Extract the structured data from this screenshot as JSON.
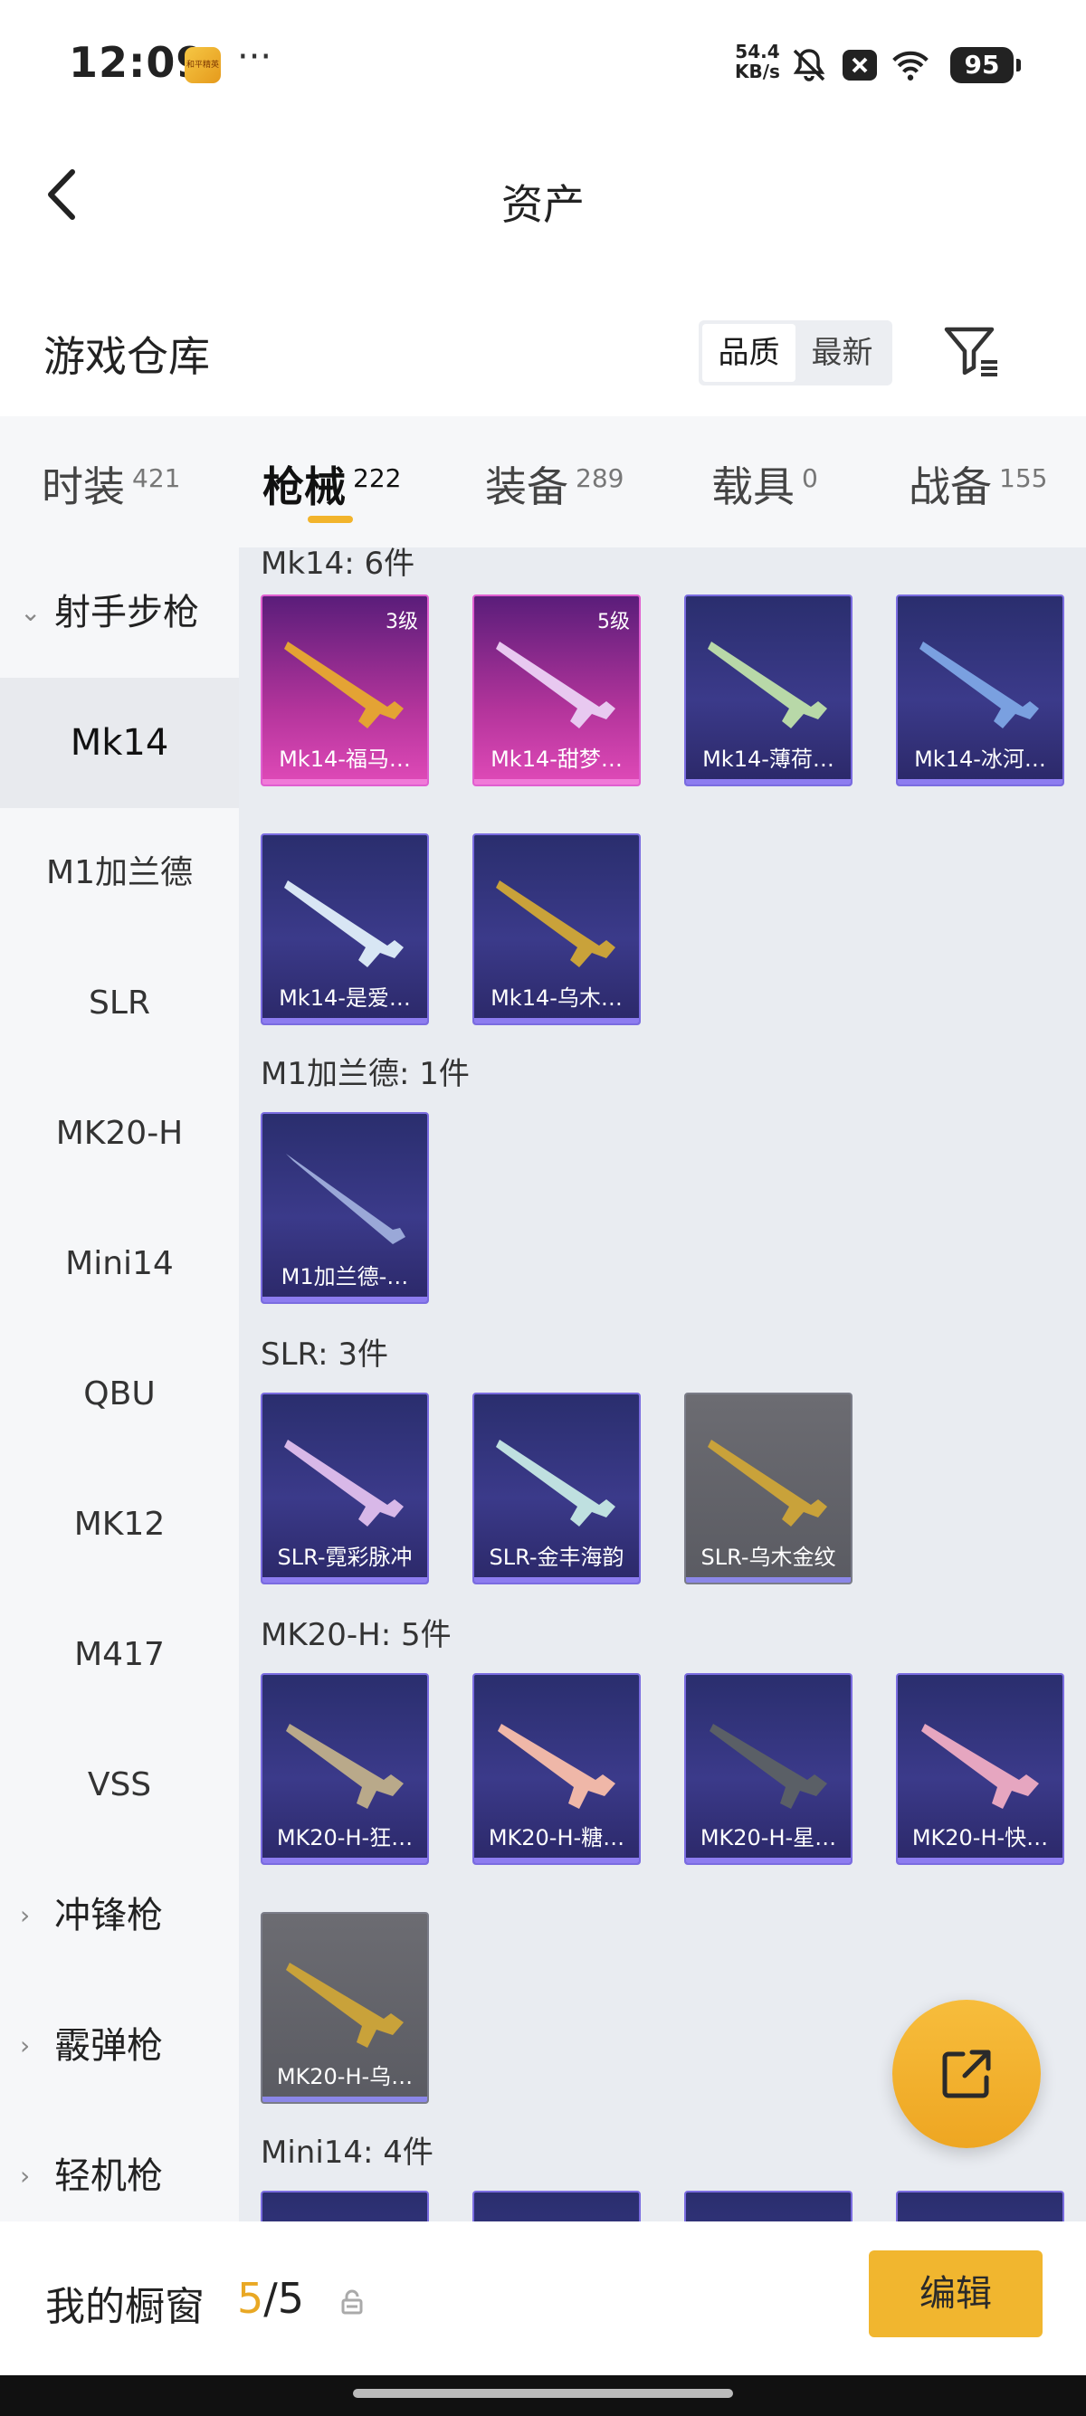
{
  "status_bar": {
    "time": "12:09",
    "app_badge_text": "和平精英",
    "more": "···",
    "net_speed_value": "54.4",
    "net_speed_unit": "KB/s",
    "battery": "95",
    "icons": [
      "bell-off-icon",
      "close-box-icon",
      "wifi-icon",
      "battery-icon"
    ]
  },
  "nav": {
    "title": "资产",
    "back_icon": "chevron-left-icon"
  },
  "header": {
    "title": "游戏仓库",
    "sort_options": [
      "品质",
      "最新"
    ],
    "sort_selected": "品质",
    "filter_icon": "filter-icon"
  },
  "tabs": [
    {
      "label": "时装",
      "count": "421"
    },
    {
      "label": "枪械",
      "count": "222",
      "active": true
    },
    {
      "label": "装备",
      "count": "289"
    },
    {
      "label": "载具",
      "count": "0"
    },
    {
      "label": "战备",
      "count": "155"
    }
  ],
  "sidebar": {
    "groups": [
      {
        "label": "射手步枪",
        "expanded": true
      },
      {
        "label": "冲锋枪",
        "expanded": false
      },
      {
        "label": "霰弹枪",
        "expanded": false
      },
      {
        "label": "轻机枪",
        "expanded": false
      }
    ],
    "items": [
      "Mk14",
      "M1加兰德",
      "SLR",
      "MK20-H",
      "Mini14",
      "QBU",
      "MK12",
      "M417",
      "VSS"
    ],
    "active_item": "Mk14"
  },
  "content": {
    "sections": [
      {
        "label": "Mk14: 6件",
        "cards": [
          {
            "name": "Mk14-福马…",
            "level": "3级",
            "rarity": "purple"
          },
          {
            "name": "Mk14-甜梦…",
            "level": "5级",
            "rarity": "purple"
          },
          {
            "name": "Mk14-薄荷…",
            "rarity": "blue"
          },
          {
            "name": "Mk14-冰河…",
            "rarity": "blue"
          },
          {
            "name": "Mk14-是爱…",
            "rarity": "blue"
          },
          {
            "name": "Mk14-乌木…",
            "rarity": "blue"
          }
        ]
      },
      {
        "label": "M1加兰德: 1件",
        "cards": [
          {
            "name": "M1加兰德-…",
            "rarity": "blue"
          }
        ]
      },
      {
        "label": "SLR: 3件",
        "cards": [
          {
            "name": "SLR-霓彩脉冲",
            "rarity": "blue"
          },
          {
            "name": "SLR-金丰海韵",
            "rarity": "blue"
          },
          {
            "name": "SLR-乌木金纹",
            "rarity": "gray"
          }
        ]
      },
      {
        "label": "MK20-H: 5件",
        "cards": [
          {
            "name": "MK20-H-狂…",
            "rarity": "blue"
          },
          {
            "name": "MK20-H-糖…",
            "rarity": "blue"
          },
          {
            "name": "MK20-H-星…",
            "rarity": "blue"
          },
          {
            "name": "MK20-H-快…",
            "rarity": "blue"
          },
          {
            "name": "MK20-H-乌…",
            "rarity": "gray"
          }
        ]
      },
      {
        "label": "Mini14: 4件",
        "cards": []
      }
    ]
  },
  "fab": {
    "icon": "share-external-icon"
  },
  "bottom": {
    "showcase_label": "我的橱窗",
    "showcase_current": "5",
    "showcase_total": "/5",
    "lock_icon": "lock-icon",
    "edit_label": "编辑"
  },
  "colors": {
    "accent": "#f1b62f",
    "blue_card": "#3b3a8a",
    "purple_card": "#b3349b",
    "gray_card": "#5a5b62"
  }
}
